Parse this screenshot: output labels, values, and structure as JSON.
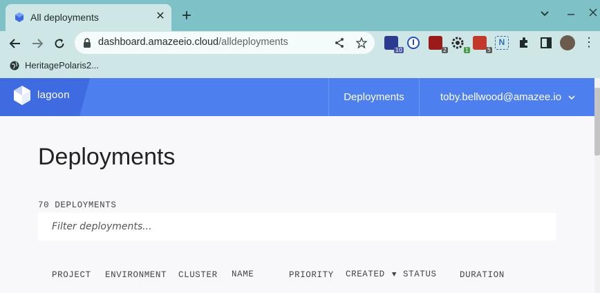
{
  "browser": {
    "tab_title": "All deployments",
    "url_host": "dashboard.amazeeio.cloud",
    "url_path": "/alldeployments",
    "bookmark_label": "HeritagePolaris2...",
    "extensions": [
      {
        "name": "graduation-cap-extension",
        "badge": "10",
        "color": "#2d3b8f"
      },
      {
        "name": "password-manager-extension",
        "badge": "",
        "color": "#1f4fbf"
      },
      {
        "name": "ublock-extension",
        "badge": "2",
        "color": "#9b1a1a"
      },
      {
        "name": "gear-extension",
        "badge": "1",
        "color": "#2a2a2a"
      },
      {
        "name": "chat-extension",
        "badge": "5",
        "color": "#c0392b"
      },
      {
        "name": "n-extension",
        "badge": "",
        "color": "#2c6db5"
      }
    ]
  },
  "app": {
    "logo_text": "lagoon",
    "nav_deployments": "Deployments",
    "user_email": "toby.bellwood@amazee.io"
  },
  "main": {
    "title": "Deployments",
    "count_label": "70 DEPLOYMENTS",
    "filter_placeholder": "Filter deployments...",
    "columns": [
      "PROJECT",
      "ENVIRONMENT",
      "CLUSTER",
      "NAME",
      "PRIORITY",
      "CREATED",
      "STATUS",
      "DURATION"
    ],
    "sorted_column": "CREATED",
    "sort_indicator": "▼"
  }
}
